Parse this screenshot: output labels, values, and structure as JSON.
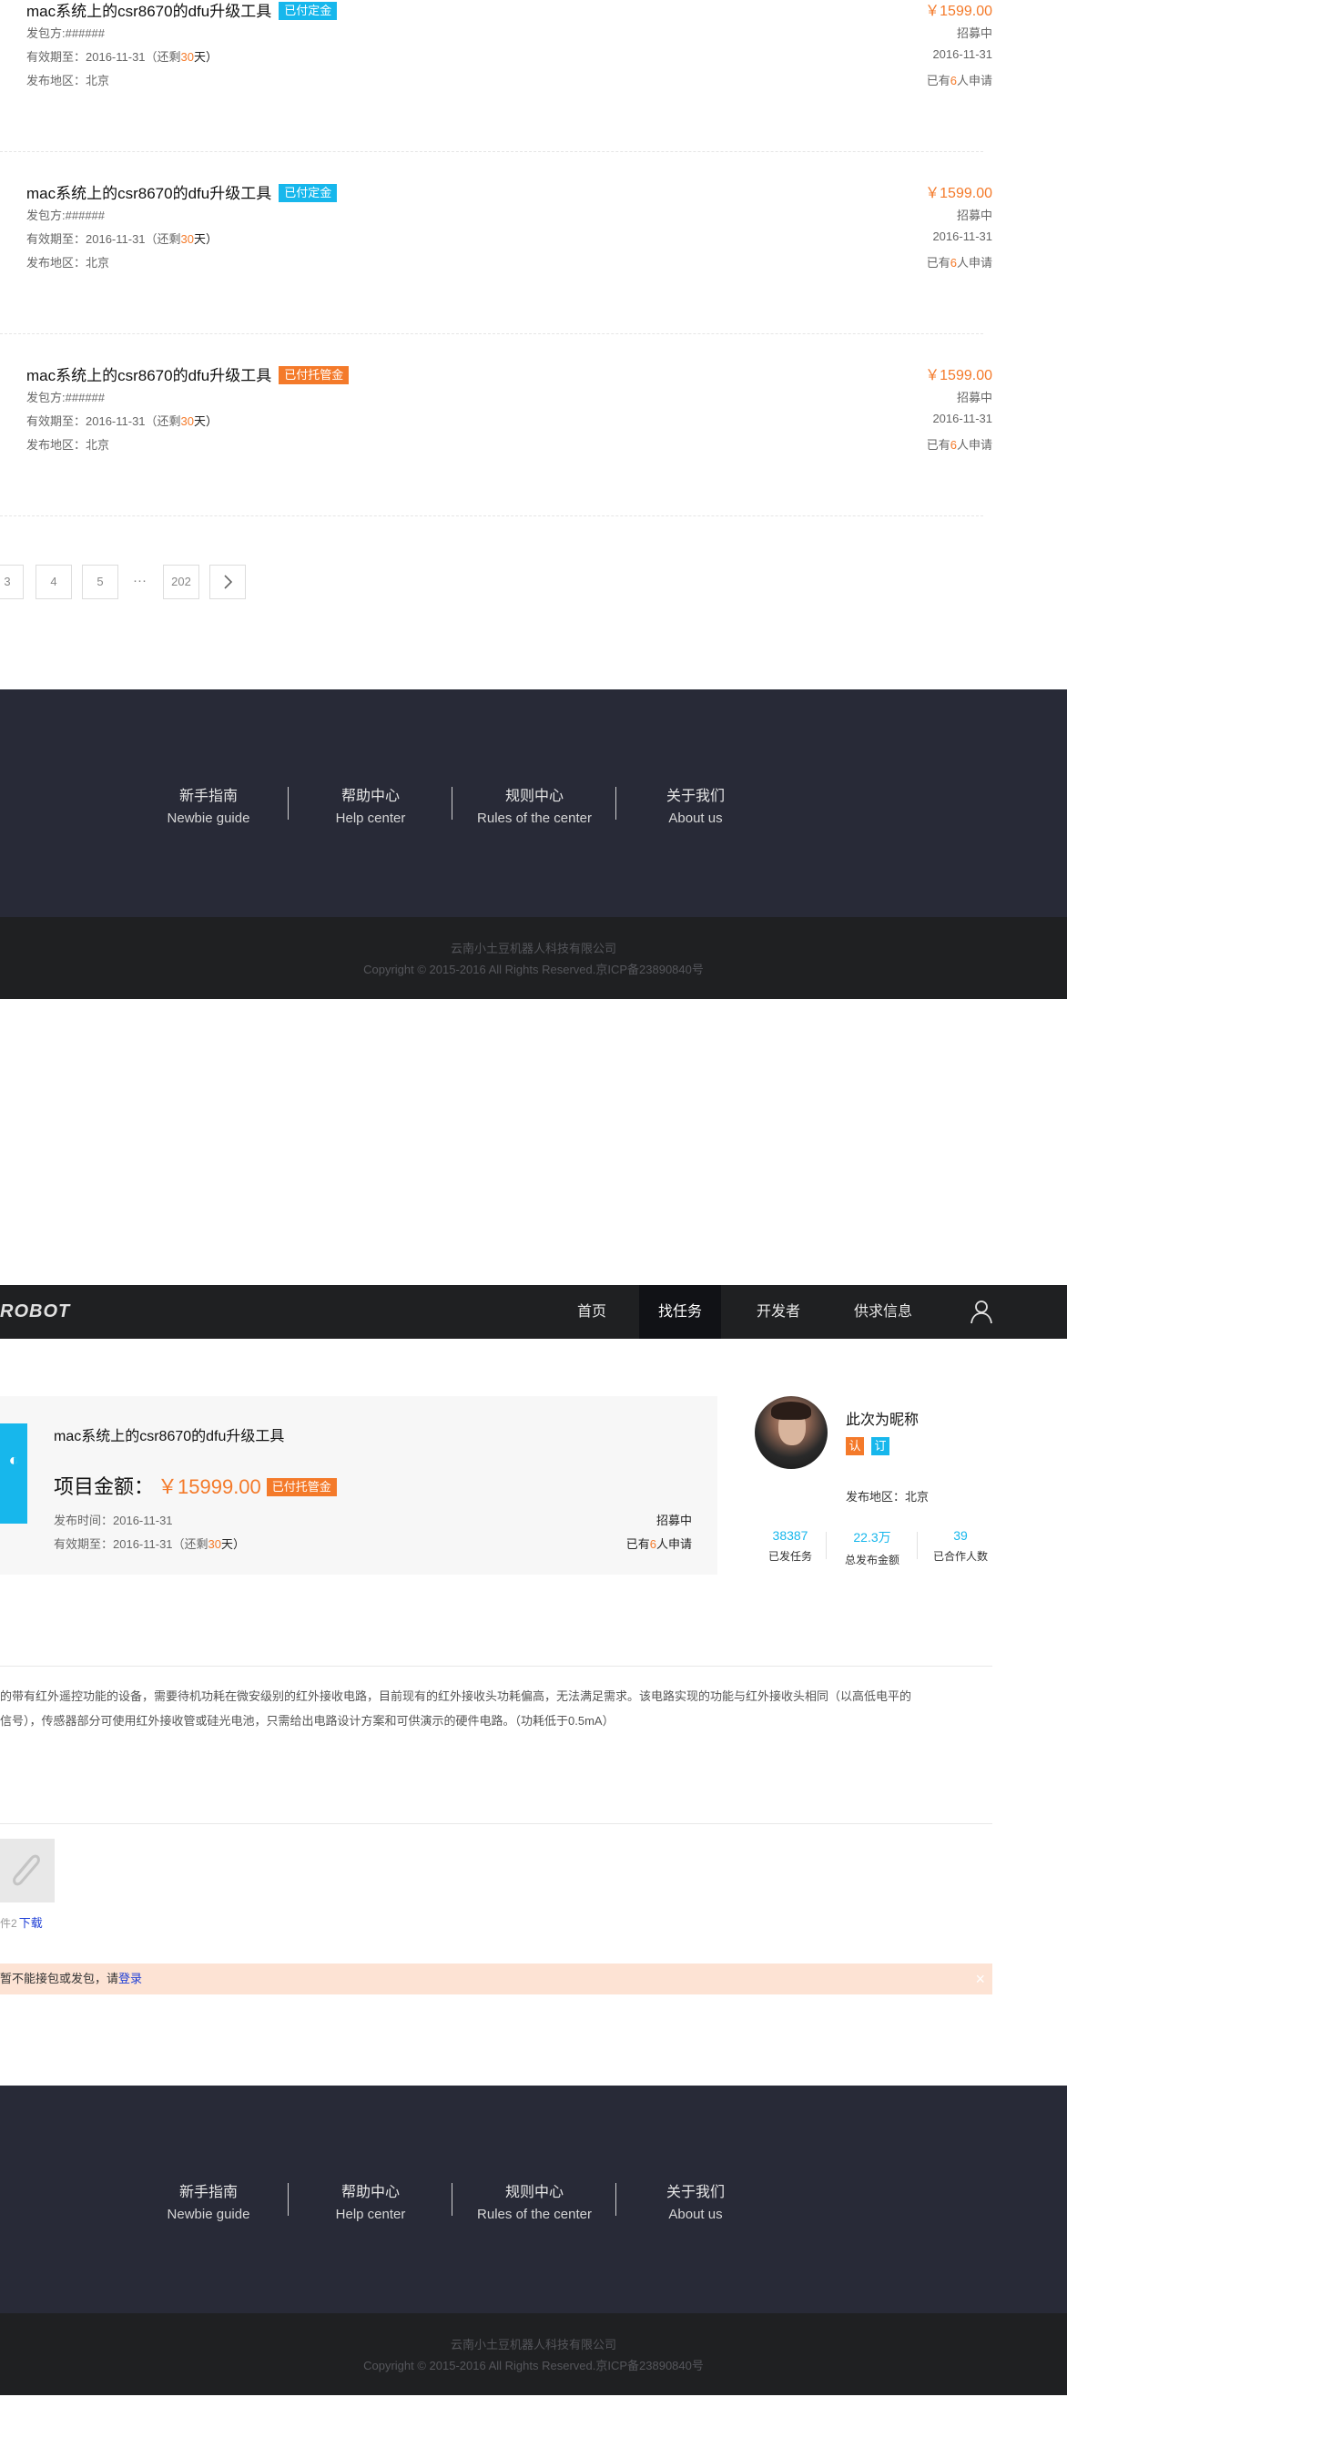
{
  "tasks": [
    {
      "title": "mac系统上的csr8670的dfu升级工具",
      "badge": "已付定金",
      "badge_color": "#17b7ec",
      "publisher_label": "发包方:",
      "publisher": "######",
      "valid_label": "有效期至：2016-11-31（还剩",
      "days_left": "30",
      "days_unit": "天）",
      "region": "发布地区：北京",
      "price": "￥1599.00",
      "status": "招募中",
      "date": "2016-11-31",
      "applicants_prefix": "已有",
      "applicants": "6",
      "applicants_suffix": "人申请"
    },
    {
      "title": "mac系统上的csr8670的dfu升级工具",
      "badge": "已付定金",
      "badge_color": "#17b7ec",
      "publisher_label": "发包方:",
      "publisher": "######",
      "valid_label": "有效期至：2016-11-31（还剩",
      "days_left": "30",
      "days_unit": "天）",
      "region": "发布地区：北京",
      "price": "￥1599.00",
      "status": "招募中",
      "date": "2016-11-31",
      "applicants_prefix": "已有",
      "applicants": "6",
      "applicants_suffix": "人申请"
    },
    {
      "title": "mac系统上的csr8670的dfu升级工具",
      "badge": "已付托管金",
      "badge_color": "#f47a2a",
      "publisher_label": "发包方:",
      "publisher": "######",
      "valid_label": "有效期至：2016-11-31（还剩",
      "days_left": "30",
      "days_unit": "天）",
      "region": "发布地区：北京",
      "price": "￥1599.00",
      "status": "招募中",
      "date": "2016-11-31",
      "applicants_prefix": "已有",
      "applicants": "6",
      "applicants_suffix": "人申请"
    }
  ],
  "pagination": {
    "pages": [
      "3",
      "4",
      "5"
    ],
    "ellipsis": "···",
    "last": "202",
    "next_icon": "chevron-right-icon"
  },
  "footer": {
    "links": [
      {
        "cn": "新手指南",
        "en": "Newbie guide"
      },
      {
        "cn": "帮助中心",
        "en": "Help center"
      },
      {
        "cn": "规则中心",
        "en": "Rules of the center"
      },
      {
        "cn": "关于我们",
        "en": "About us"
      }
    ],
    "company": "云南小土豆机器人科技有限公司",
    "copyright": "Copyright © 2015-2016  All Rights Reserved.京ICP备23890840号"
  },
  "header": {
    "logo": "ROBOT",
    "nav": [
      "首页",
      "找任务",
      "开发者",
      "供求信息"
    ],
    "active_nav": "找任务",
    "user_icon": "user-icon"
  },
  "project": {
    "title": "mac系统上的csr8670的dfu升级工具",
    "amount_label": "项目金额：",
    "amount": "￥15999.00",
    "badge": "已付托管金",
    "publish_time": "发布时间：2016-11-31",
    "valid_label": "有效期至：2016-11-31（还剩",
    "days_left": "30",
    "days_unit": "天）",
    "status": "招募中",
    "applicants_prefix": "已有",
    "applicants": "6",
    "applicants_suffix": "人申请"
  },
  "profile": {
    "nickname": "此次为昵称",
    "tags": [
      {
        "text": "认",
        "color": "#f47a2a"
      },
      {
        "text": "订",
        "color": "#17b7ec"
      }
    ],
    "region": "发布地区：北京",
    "stats": [
      {
        "num": "38387",
        "label": "已发任务"
      },
      {
        "num": "22.3万",
        "label": "总发布金额"
      },
      {
        "num": "39",
        "label": "已合作人数"
      }
    ]
  },
  "description": {
    "line1": "的带有红外遥控功能的设备，需要待机功耗在微安级别的红外接收电路，目前现有的红外接收头功耗偏高，无法满足需求。该电路实现的功能与红外接收头相同（以高低电平的",
    "line2": "信号），传感器部分可使用红外接收管或硅光电池，只需给出电路设计方案和可供演示的硬件电路。（功耗低于0.5mA）"
  },
  "attachment": {
    "label": "件2",
    "download": "下载",
    "icon": "paperclip-icon"
  },
  "notice": {
    "text": "暂不能接包或发包，请",
    "link": "登录",
    "close": "×"
  }
}
